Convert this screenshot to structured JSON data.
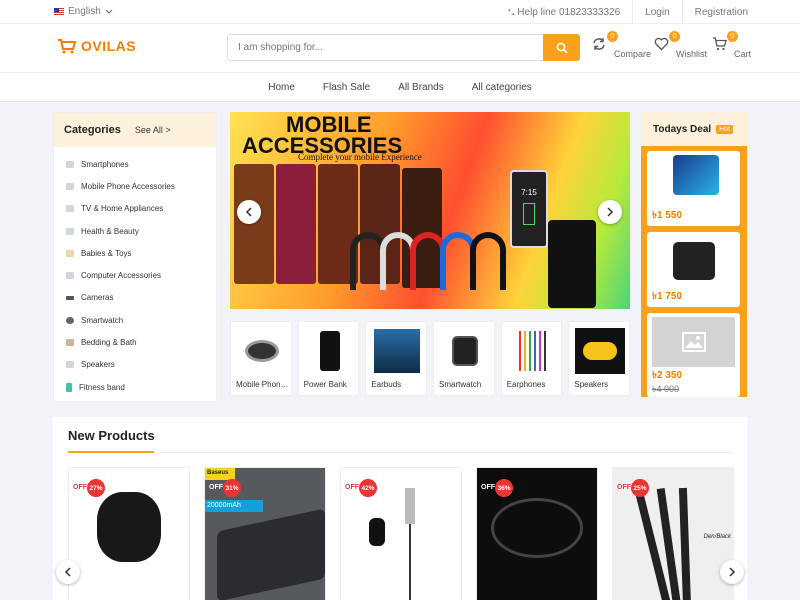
{
  "topbar": {
    "language": "English",
    "helpline": "Help line 01823333326",
    "login": "Login",
    "registration": "Registration"
  },
  "header": {
    "logo_text": "OVILAS",
    "search_placeholder": "I am shopping for...",
    "compare": {
      "label": "Compare",
      "count": "0"
    },
    "wishlist": {
      "label": "Wishlist",
      "count": "0"
    },
    "cart": {
      "label": "Cart",
      "count": "0"
    }
  },
  "nav": {
    "items": [
      "Home",
      "Flash Sale",
      "All Brands",
      "All categories"
    ]
  },
  "categories": {
    "title": "Categories",
    "see_all": "See All >",
    "items": [
      "Smartphones",
      "Mobile Phone Accessories",
      "TV & Home Appliances",
      "Health & Beauty",
      "Babies & Toys",
      "Computer Accessories",
      "Cameras",
      "Smartwatch",
      "Bedding & Bath",
      "Speakers",
      "Fitness band"
    ]
  },
  "banner": {
    "title_line1": "MOBILE",
    "title_line2": "ACCESSORIES",
    "subtitle": "Complete your mobile Experience",
    "phone_time": "7:15"
  },
  "thumbs": [
    "Mobile Phone Accessories",
    "Power Bank",
    "Earbuds",
    "Smartwatch",
    "Earphones",
    "Speakers"
  ],
  "deal": {
    "title": "Todays Deal",
    "badge": "Hot",
    "items": [
      {
        "price": "৳1 550"
      },
      {
        "price": "৳1 750"
      },
      {
        "price": "৳2 350",
        "old_price": "৳4 000"
      }
    ]
  },
  "new_products": {
    "title": "New Products",
    "off_label": "OFF",
    "cards": [
      {
        "discount": "27%"
      },
      {
        "discount": "31%",
        "brand": "Baseus",
        "capacity": "20000mAh"
      },
      {
        "discount": "42%"
      },
      {
        "discount": "36%"
      },
      {
        "discount": "25%",
        "brand": "Den/Black"
      }
    ]
  },
  "colors": {
    "accent": "#f9a11b",
    "logo": "#f57c00",
    "discount": "#e33333",
    "panel_header": "#fef1dc"
  }
}
